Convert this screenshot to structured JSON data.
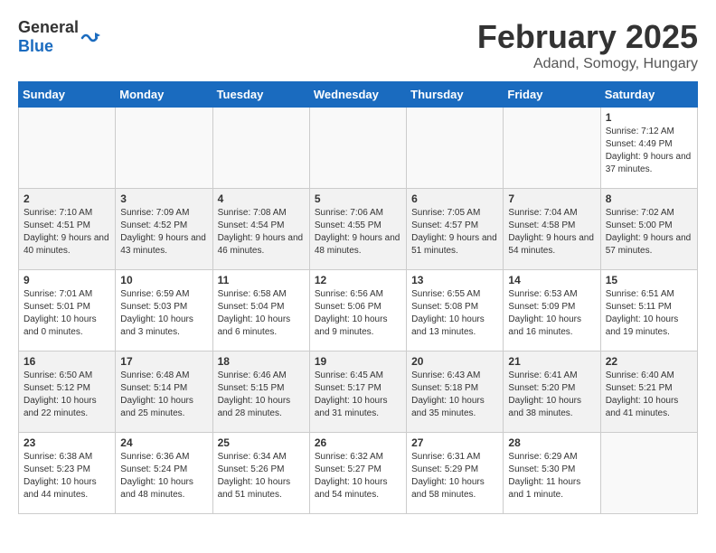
{
  "header": {
    "logo_general": "General",
    "logo_blue": "Blue",
    "month_title": "February 2025",
    "location": "Adand, Somogy, Hungary"
  },
  "days_of_week": [
    "Sunday",
    "Monday",
    "Tuesday",
    "Wednesday",
    "Thursday",
    "Friday",
    "Saturday"
  ],
  "weeks": [
    [
      {
        "day": "",
        "info": ""
      },
      {
        "day": "",
        "info": ""
      },
      {
        "day": "",
        "info": ""
      },
      {
        "day": "",
        "info": ""
      },
      {
        "day": "",
        "info": ""
      },
      {
        "day": "",
        "info": ""
      },
      {
        "day": "1",
        "info": "Sunrise: 7:12 AM\nSunset: 4:49 PM\nDaylight: 9 hours and 37 minutes."
      }
    ],
    [
      {
        "day": "2",
        "info": "Sunrise: 7:10 AM\nSunset: 4:51 PM\nDaylight: 9 hours and 40 minutes."
      },
      {
        "day": "3",
        "info": "Sunrise: 7:09 AM\nSunset: 4:52 PM\nDaylight: 9 hours and 43 minutes."
      },
      {
        "day": "4",
        "info": "Sunrise: 7:08 AM\nSunset: 4:54 PM\nDaylight: 9 hours and 46 minutes."
      },
      {
        "day": "5",
        "info": "Sunrise: 7:06 AM\nSunset: 4:55 PM\nDaylight: 9 hours and 48 minutes."
      },
      {
        "day": "6",
        "info": "Sunrise: 7:05 AM\nSunset: 4:57 PM\nDaylight: 9 hours and 51 minutes."
      },
      {
        "day": "7",
        "info": "Sunrise: 7:04 AM\nSunset: 4:58 PM\nDaylight: 9 hours and 54 minutes."
      },
      {
        "day": "8",
        "info": "Sunrise: 7:02 AM\nSunset: 5:00 PM\nDaylight: 9 hours and 57 minutes."
      }
    ],
    [
      {
        "day": "9",
        "info": "Sunrise: 7:01 AM\nSunset: 5:01 PM\nDaylight: 10 hours and 0 minutes."
      },
      {
        "day": "10",
        "info": "Sunrise: 6:59 AM\nSunset: 5:03 PM\nDaylight: 10 hours and 3 minutes."
      },
      {
        "day": "11",
        "info": "Sunrise: 6:58 AM\nSunset: 5:04 PM\nDaylight: 10 hours and 6 minutes."
      },
      {
        "day": "12",
        "info": "Sunrise: 6:56 AM\nSunset: 5:06 PM\nDaylight: 10 hours and 9 minutes."
      },
      {
        "day": "13",
        "info": "Sunrise: 6:55 AM\nSunset: 5:08 PM\nDaylight: 10 hours and 13 minutes."
      },
      {
        "day": "14",
        "info": "Sunrise: 6:53 AM\nSunset: 5:09 PM\nDaylight: 10 hours and 16 minutes."
      },
      {
        "day": "15",
        "info": "Sunrise: 6:51 AM\nSunset: 5:11 PM\nDaylight: 10 hours and 19 minutes."
      }
    ],
    [
      {
        "day": "16",
        "info": "Sunrise: 6:50 AM\nSunset: 5:12 PM\nDaylight: 10 hours and 22 minutes."
      },
      {
        "day": "17",
        "info": "Sunrise: 6:48 AM\nSunset: 5:14 PM\nDaylight: 10 hours and 25 minutes."
      },
      {
        "day": "18",
        "info": "Sunrise: 6:46 AM\nSunset: 5:15 PM\nDaylight: 10 hours and 28 minutes."
      },
      {
        "day": "19",
        "info": "Sunrise: 6:45 AM\nSunset: 5:17 PM\nDaylight: 10 hours and 31 minutes."
      },
      {
        "day": "20",
        "info": "Sunrise: 6:43 AM\nSunset: 5:18 PM\nDaylight: 10 hours and 35 minutes."
      },
      {
        "day": "21",
        "info": "Sunrise: 6:41 AM\nSunset: 5:20 PM\nDaylight: 10 hours and 38 minutes."
      },
      {
        "day": "22",
        "info": "Sunrise: 6:40 AM\nSunset: 5:21 PM\nDaylight: 10 hours and 41 minutes."
      }
    ],
    [
      {
        "day": "23",
        "info": "Sunrise: 6:38 AM\nSunset: 5:23 PM\nDaylight: 10 hours and 44 minutes."
      },
      {
        "day": "24",
        "info": "Sunrise: 6:36 AM\nSunset: 5:24 PM\nDaylight: 10 hours and 48 minutes."
      },
      {
        "day": "25",
        "info": "Sunrise: 6:34 AM\nSunset: 5:26 PM\nDaylight: 10 hours and 51 minutes."
      },
      {
        "day": "26",
        "info": "Sunrise: 6:32 AM\nSunset: 5:27 PM\nDaylight: 10 hours and 54 minutes."
      },
      {
        "day": "27",
        "info": "Sunrise: 6:31 AM\nSunset: 5:29 PM\nDaylight: 10 hours and 58 minutes."
      },
      {
        "day": "28",
        "info": "Sunrise: 6:29 AM\nSunset: 5:30 PM\nDaylight: 11 hours and 1 minute."
      },
      {
        "day": "",
        "info": ""
      }
    ]
  ]
}
